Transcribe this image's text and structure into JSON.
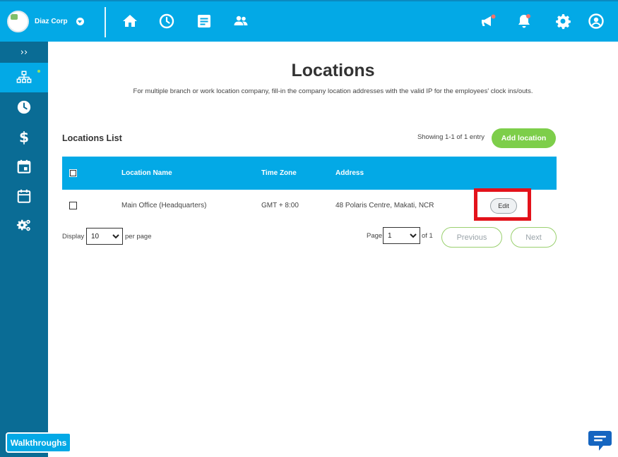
{
  "header": {
    "company_name": "Diaz Corp",
    "accent_color": "#03a9e6",
    "nav_icons": [
      "home-icon",
      "clock-icon",
      "document-icon",
      "people-icon"
    ],
    "right_icons": [
      "megaphone-icon",
      "bell-icon",
      "gear-icon",
      "user-icon"
    ]
  },
  "sidebar": {
    "toggle": "››",
    "items": [
      "org-chart-icon",
      "clock-icon",
      "dollar-icon",
      "calendar-event-icon",
      "calendar-icon",
      "gears-icon"
    ],
    "active_index": 0,
    "bg_color": "#0a6c95"
  },
  "page": {
    "title": "Locations",
    "subtitle": "For multiple branch or work location company, fill-in the company location addresses with the valid IP for the employees' clock ins/outs."
  },
  "list": {
    "title": "Locations List",
    "showing": "Showing 1-1 of 1 entry",
    "add_label": "Add location",
    "columns": [
      "Location Name",
      "Time Zone",
      "Address"
    ],
    "rows": [
      {
        "name": "Main Office (Headquarters)",
        "timezone": "GMT + 8:00",
        "address": "48 Polaris Centre, Makati, NCR",
        "action": "Edit"
      }
    ]
  },
  "pagination": {
    "display_label": "Display",
    "per_page_value": "10",
    "per_page_label": "per page",
    "page_label": "Page",
    "page_value": "1",
    "of_label": "of 1",
    "previous_label": "Previous",
    "next_label": "Next"
  },
  "walkthroughs_label": "Walkthroughs"
}
